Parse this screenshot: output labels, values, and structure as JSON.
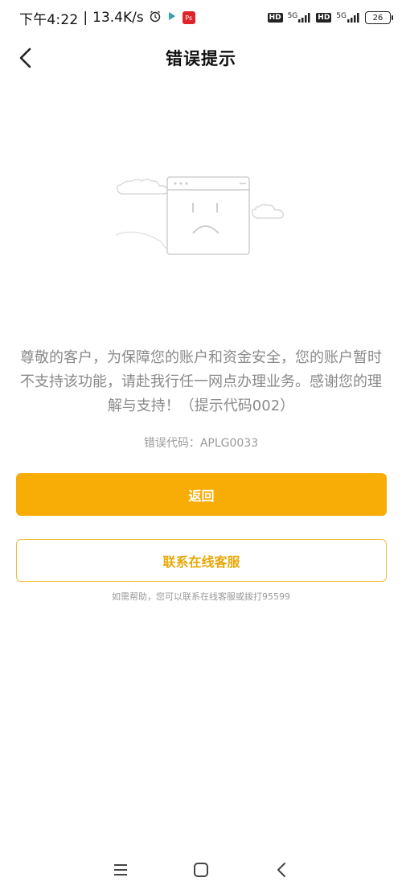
{
  "status_bar": {
    "time": "下午4:22",
    "separator": "|",
    "speed": "13.4K/s",
    "network_1": "5G",
    "network_2": "5G",
    "hd_1": "HD",
    "hd_2": "HD",
    "battery": "26",
    "app_badge": "Ps"
  },
  "header": {
    "title": "错误提示"
  },
  "message": {
    "body": "尊敬的客户，为保障您的账户和资金安全，您的账户暂时不支持该功能，请赴我行任一网点办理业务。感谢您的理解与支持！（提示代码002）",
    "error_code": "错误代码：APLG0033"
  },
  "actions": {
    "return_label": "返回",
    "contact_label": "联系在线客服",
    "help_text": "如需帮助，您可以联系在线客服或拨打95599"
  },
  "colors": {
    "primary": "#f8ac06",
    "outline_border": "#f1bf3f",
    "outline_text": "#e8a80a",
    "message_text": "#8a8a8a"
  },
  "icons": {
    "back": "back-chevron-icon",
    "illustration": "sad-browser-window-icon",
    "nav_menu": "menu-icon",
    "nav_home": "home-square-icon",
    "nav_back": "back-triangle-icon"
  }
}
